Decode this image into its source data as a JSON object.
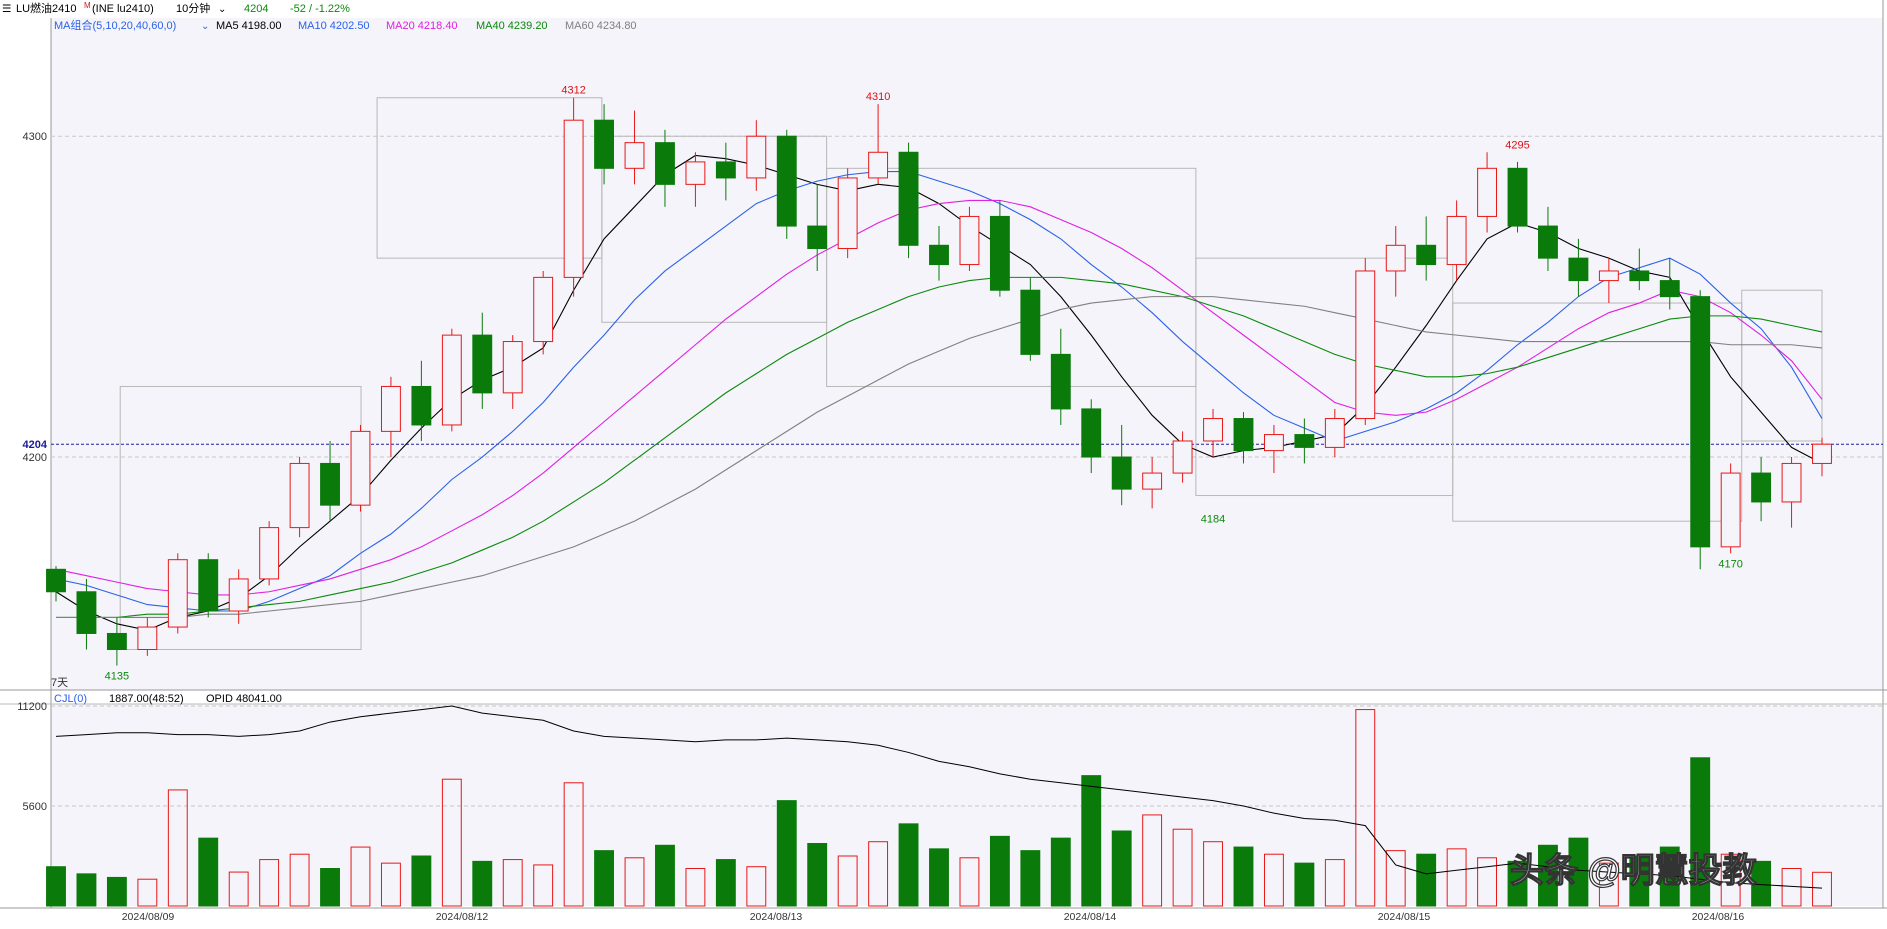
{
  "header": {
    "symbol": "LU燃油2410",
    "symbol_sup": "M",
    "exchange_code": "(INE lu2410)",
    "period": "10分钟",
    "last": "4204",
    "change": "-52 / -1.22%"
  },
  "ma_legend": {
    "group": "MA组合(5,10,20,40,60,0)",
    "items": [
      {
        "label": "MA5 4198.00",
        "color": "#000000"
      },
      {
        "label": "MA10 4202.50",
        "color": "#2b62e8"
      },
      {
        "label": "MA20 4218.40",
        "color": "#e020e0"
      },
      {
        "label": "MA40 4239.20",
        "color": "#0a8a0a"
      },
      {
        "label": "MA60 4234.80",
        "color": "#808080"
      }
    ]
  },
  "vol_legend": {
    "name": "CJL(0)",
    "volume": "1887.00(48:52)",
    "opid": "OPID 48041.00"
  },
  "price_axis": {
    "ticks": [
      "4300",
      "4200"
    ],
    "current": "4204"
  },
  "volume_axis": {
    "ticks": [
      "11200",
      "5600"
    ]
  },
  "dates": [
    "2024/08/09",
    "2024/08/12",
    "2024/08/13",
    "2024/08/14",
    "2024/08/15",
    "2024/08/16"
  ],
  "corner_label": "7天",
  "annotations": [
    {
      "text": "4312",
      "color": "#e01010",
      "x_index": 17,
      "price": 4312
    },
    {
      "text": "4310",
      "color": "#e01010",
      "x_index": 27,
      "price": 4310
    },
    {
      "text": "4295",
      "color": "#e01010",
      "x_index": 48,
      "price": 4295
    },
    {
      "text": "4135",
      "color": "#0a8a0a",
      "x_index": 2,
      "price": 4135
    },
    {
      "text": "4184",
      "color": "#0a8a0a",
      "x_index": 38,
      "price": 4184
    },
    {
      "text": "4170",
      "color": "#0a8a0a",
      "x_index": 55,
      "price": 4170
    }
  ],
  "watermark": "头条 @明慧投教",
  "colors": {
    "up": "#e81818",
    "down": "#0a7a0a",
    "bg": "#f4f4fa",
    "grid": "#c8c8c8",
    "current_line": "#2020a0"
  },
  "chart_data": {
    "type": "candlestick",
    "period": "10分钟",
    "price_range": [
      4128,
      4330
    ],
    "volume_range": [
      0,
      11200
    ],
    "bars": [
      [
        4165,
        4166,
        4155,
        4158,
        2200
      ],
      [
        4158,
        4162,
        4140,
        4145,
        1800
      ],
      [
        4145,
        4150,
        4135,
        4140,
        1600
      ],
      [
        4140,
        4150,
        4138,
        4147,
        1500
      ],
      [
        4147,
        4170,
        4145,
        4168,
        6500
      ],
      [
        4168,
        4170,
        4150,
        4152,
        3800
      ],
      [
        4152,
        4165,
        4148,
        4162,
        1900
      ],
      [
        4162,
        4180,
        4160,
        4178,
        2600
      ],
      [
        4178,
        4200,
        4175,
        4198,
        2900
      ],
      [
        4198,
        4205,
        4180,
        4185,
        2100
      ],
      [
        4185,
        4210,
        4183,
        4208,
        3300
      ],
      [
        4208,
        4225,
        4200,
        4222,
        2400
      ],
      [
        4222,
        4230,
        4205,
        4210,
        2800
      ],
      [
        4210,
        4240,
        4208,
        4238,
        7100
      ],
      [
        4238,
        4245,
        4215,
        4220,
        2500
      ],
      [
        4220,
        4238,
        4215,
        4236,
        2600
      ],
      [
        4236,
        4258,
        4232,
        4256,
        2300
      ],
      [
        4256,
        4312,
        4250,
        4305,
        6900
      ],
      [
        4305,
        4310,
        4285,
        4290,
        3100
      ],
      [
        4290,
        4308,
        4285,
        4298,
        2700
      ],
      [
        4298,
        4302,
        4278,
        4285,
        3400
      ],
      [
        4285,
        4295,
        4278,
        4292,
        2100
      ],
      [
        4292,
        4298,
        4280,
        4287,
        2600
      ],
      [
        4287,
        4305,
        4283,
        4300,
        2200
      ],
      [
        4300,
        4302,
        4268,
        4272,
        5900
      ],
      [
        4272,
        4285,
        4258,
        4265,
        3500
      ],
      [
        4265,
        4290,
        4262,
        4287,
        2800
      ],
      [
        4287,
        4310,
        4285,
        4295,
        3600
      ],
      [
        4295,
        4298,
        4262,
        4266,
        4600
      ],
      [
        4266,
        4272,
        4255,
        4260,
        3200
      ],
      [
        4260,
        4278,
        4258,
        4275,
        2700
      ],
      [
        4275,
        4280,
        4250,
        4252,
        3900
      ],
      [
        4252,
        4256,
        4230,
        4232,
        3100
      ],
      [
        4232,
        4240,
        4210,
        4215,
        3800
      ],
      [
        4215,
        4218,
        4195,
        4200,
        7300
      ],
      [
        4200,
        4210,
        4185,
        4190,
        4200
      ],
      [
        4190,
        4200,
        4184,
        4195,
        5100
      ],
      [
        4195,
        4208,
        4192,
        4205,
        4300
      ],
      [
        4205,
        4215,
        4200,
        4212,
        3600
      ],
      [
        4212,
        4214,
        4198,
        4202,
        3300
      ],
      [
        4202,
        4210,
        4195,
        4207,
        2900
      ],
      [
        4207,
        4212,
        4198,
        4203,
        2400
      ],
      [
        4203,
        4215,
        4200,
        4212,
        2600
      ],
      [
        4212,
        4262,
        4210,
        4258,
        11000
      ],
      [
        4258,
        4272,
        4250,
        4266,
        3100
      ],
      [
        4266,
        4275,
        4255,
        4260,
        2900
      ],
      [
        4260,
        4280,
        4255,
        4275,
        3200
      ],
      [
        4275,
        4295,
        4270,
        4290,
        2700
      ],
      [
        4290,
        4292,
        4270,
        4272,
        2500
      ],
      [
        4272,
        4278,
        4258,
        4262,
        3400
      ],
      [
        4262,
        4268,
        4250,
        4255,
        3800
      ],
      [
        4255,
        4262,
        4248,
        4258,
        2400
      ],
      [
        4258,
        4265,
        4252,
        4255,
        2800
      ],
      [
        4255,
        4262,
        4246,
        4250,
        3300
      ],
      [
        4250,
        4252,
        4165,
        4172,
        8300
      ],
      [
        4172,
        4198,
        4170,
        4195,
        2900
      ],
      [
        4195,
        4200,
        4180,
        4186,
        2500
      ],
      [
        4186,
        4200,
        4178,
        4198,
        2100
      ],
      [
        4198,
        4206,
        4194,
        4204,
        1887
      ]
    ],
    "ma": {
      "MA5": [
        4158,
        4152,
        4148,
        4146,
        4150,
        4152,
        4156,
        4163,
        4172,
        4180,
        4188,
        4199,
        4209,
        4218,
        4224,
        4228,
        4234,
        4252,
        4268,
        4278,
        4288,
        4294,
        4293,
        4291,
        4288,
        4285,
        4283,
        4285,
        4284,
        4279,
        4272,
        4266,
        4260,
        4250,
        4238,
        4225,
        4213,
        4204,
        4200,
        4202,
        4203,
        4205,
        4207,
        4216,
        4228,
        4241,
        4255,
        4268,
        4273,
        4270,
        4265,
        4262,
        4258,
        4256,
        4240,
        4225,
        4214,
        4203,
        4198
      ],
      "MA10": [
        4162,
        4160,
        4157,
        4154,
        4153,
        4152,
        4152,
        4155,
        4159,
        4163,
        4170,
        4176,
        4184,
        4193,
        4200,
        4208,
        4217,
        4228,
        4238,
        4249,
        4258,
        4265,
        4272,
        4279,
        4283,
        4286,
        4288,
        4289,
        4289,
        4286,
        4283,
        4279,
        4274,
        4268,
        4260,
        4253,
        4245,
        4236,
        4228,
        4220,
        4213,
        4209,
        4205,
        4208,
        4211,
        4215,
        4220,
        4227,
        4235,
        4242,
        4250,
        4256,
        4259,
        4262,
        4257,
        4248,
        4240,
        4228,
        4212
      ],
      "MA20": [
        4165,
        4163,
        4161,
        4159,
        4158,
        4157,
        4157,
        4158,
        4160,
        4162,
        4165,
        4168,
        4172,
        4177,
        4182,
        4188,
        4195,
        4203,
        4211,
        4219,
        4227,
        4235,
        4243,
        4250,
        4257,
        4263,
        4268,
        4273,
        4277,
        4279,
        4280,
        4280,
        4278,
        4274,
        4270,
        4265,
        4259,
        4252,
        4245,
        4238,
        4231,
        4224,
        4217,
        4214,
        4213,
        4214,
        4218,
        4223,
        4228,
        4234,
        4240,
        4245,
        4248,
        4252,
        4250,
        4245,
        4238,
        4230,
        4218
      ],
      "MA40": [
        4150,
        4150,
        4150,
        4151,
        4151,
        4152,
        4153,
        4154,
        4155,
        4157,
        4159,
        4161,
        4164,
        4167,
        4171,
        4175,
        4180,
        4186,
        4192,
        4199,
        4206,
        4213,
        4220,
        4226,
        4232,
        4237,
        4242,
        4246,
        4250,
        4253,
        4255,
        4256,
        4256,
        4256,
        4255,
        4254,
        4252,
        4250,
        4247,
        4244,
        4240,
        4236,
        4232,
        4229,
        4227,
        4225,
        4225,
        4226,
        4228,
        4231,
        4234,
        4237,
        4240,
        4243,
        4244,
        4244,
        4243,
        4241,
        4239
      ],
      "MA60": [
        4150,
        4150,
        4150,
        4150,
        4150,
        4151,
        4151,
        4152,
        4153,
        4154,
        4155,
        4157,
        4159,
        4161,
        4163,
        4166,
        4169,
        4172,
        4176,
        4180,
        4185,
        4190,
        4196,
        4202,
        4208,
        4214,
        4219,
        4224,
        4229,
        4233,
        4237,
        4240,
        4243,
        4246,
        4248,
        4249,
        4250,
        4250,
        4250,
        4249,
        4248,
        4247,
        4245,
        4243,
        4241,
        4239,
        4238,
        4237,
        4236,
        4236,
        4236,
        4236,
        4236,
        4236,
        4236,
        4235,
        4235,
        4235,
        4234
      ]
    },
    "opid": [
      9500,
      9600,
      9700,
      9700,
      9600,
      9600,
      9500,
      9600,
      9800,
      10300,
      10600,
      10800,
      11000,
      11200,
      10800,
      10600,
      10400,
      9800,
      9500,
      9400,
      9300,
      9200,
      9300,
      9300,
      9400,
      9300,
      9200,
      9000,
      8600,
      8100,
      7800,
      7400,
      7100,
      6900,
      6700,
      6500,
      6300,
      6100,
      5900,
      5600,
      5200,
      4900,
      4800,
      4500,
      2300,
      1800,
      2000,
      2200,
      2400,
      2200,
      2000,
      1900,
      1800,
      1700,
      1500,
      1300,
      1200,
      1100,
      1000
    ]
  }
}
